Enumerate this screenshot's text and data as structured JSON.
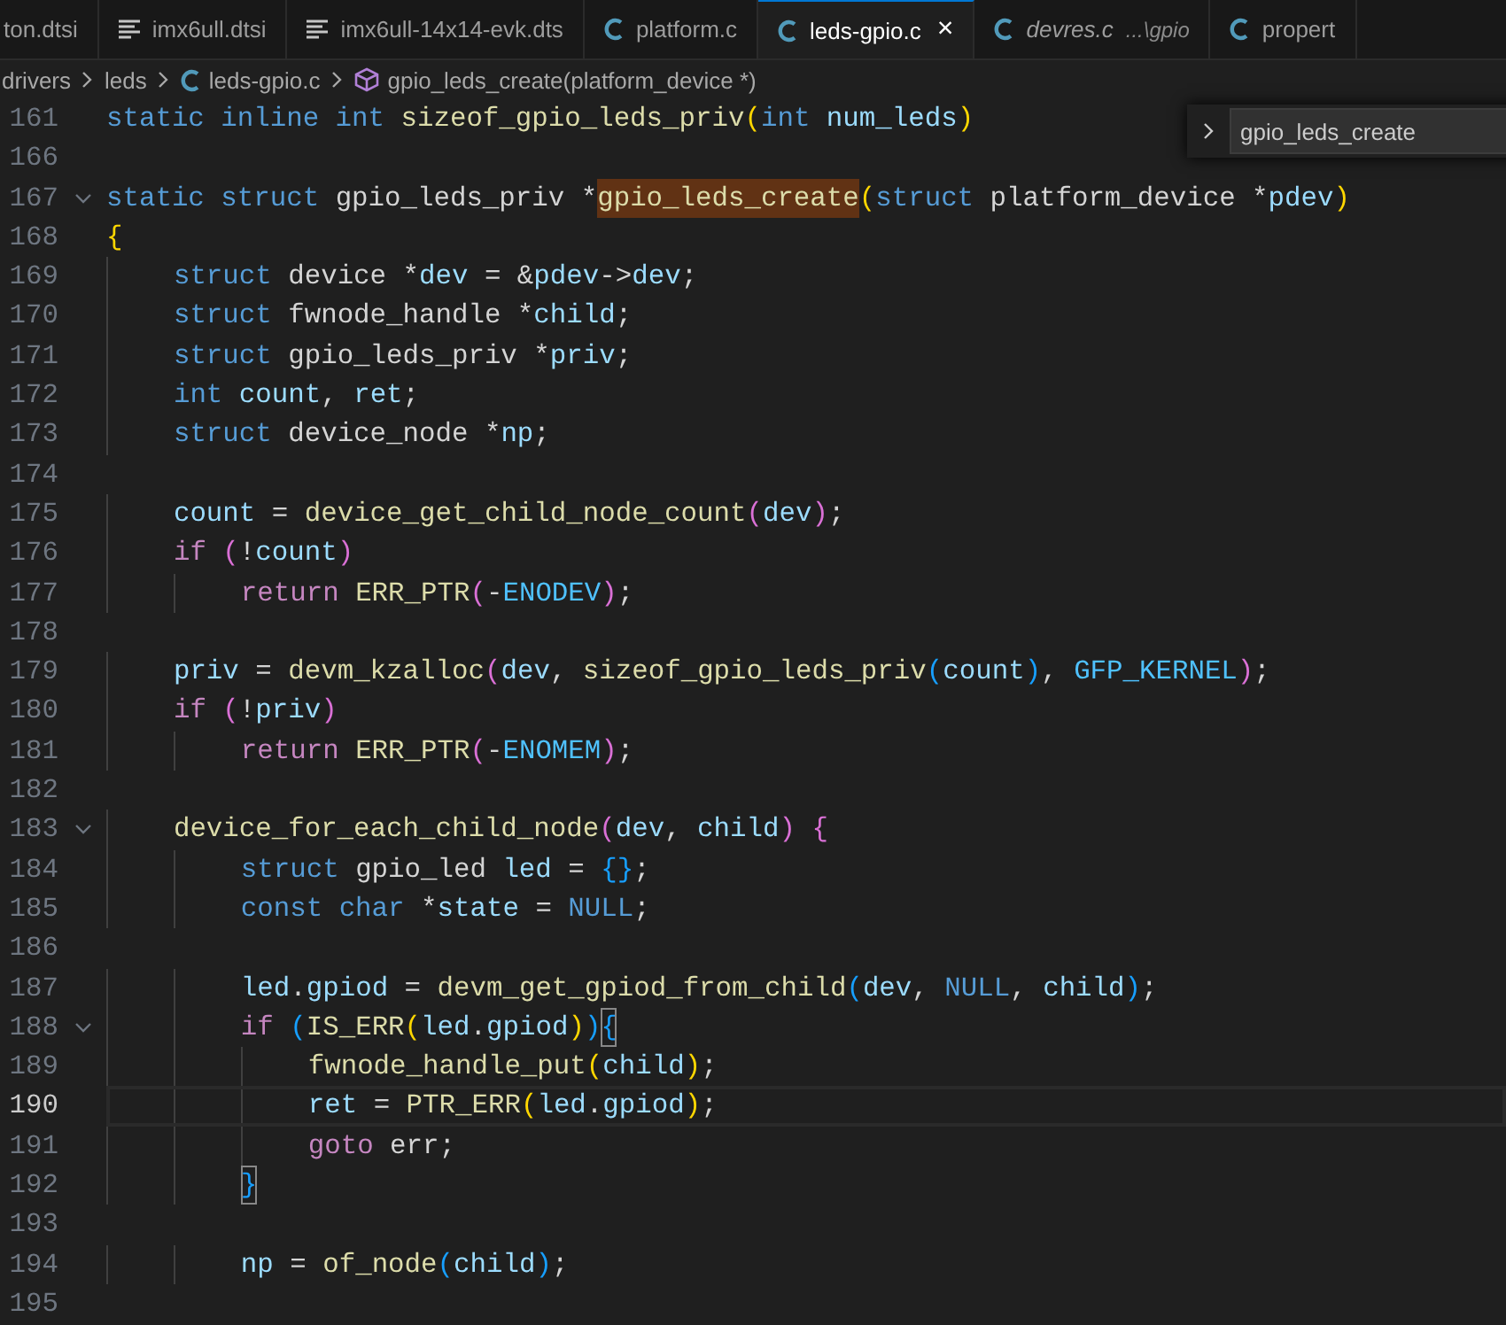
{
  "tabs": [
    {
      "label": "ton.dtsi",
      "kind": "plain",
      "selected": false,
      "preview": false
    },
    {
      "label": "imx6ull.dtsi",
      "kind": "dts",
      "selected": false,
      "preview": false
    },
    {
      "label": "imx6ull-14x14-evk.dts",
      "kind": "dts",
      "selected": false,
      "preview": false
    },
    {
      "label": "platform.c",
      "kind": "c",
      "selected": false,
      "preview": false
    },
    {
      "label": "leds-gpio.c",
      "kind": "c",
      "selected": true,
      "preview": false,
      "close": "×"
    },
    {
      "label": "devres.c",
      "kind": "c",
      "selected": false,
      "preview": true,
      "description": "...\\gpio"
    },
    {
      "label": "propert",
      "kind": "c",
      "selected": false,
      "preview": false
    }
  ],
  "breadcrumb": [
    {
      "label": "drivers",
      "kind": "folder"
    },
    {
      "label": "leds",
      "kind": "folder"
    },
    {
      "label": "leds-gpio.c",
      "kind": "c"
    },
    {
      "label": "gpio_leds_create(platform_device *)",
      "kind": "symbol"
    }
  ],
  "find_widget": {
    "value": "gpio_leds_create"
  },
  "lines": [
    {
      "number": "161",
      "tokens": [
        {
          "kind": "kw",
          "text": "static inline int "
        },
        {
          "kind": "fn",
          "text": "sizeof_gpio_leds_priv"
        },
        {
          "kind": "b1",
          "text": "("
        },
        {
          "kind": "kw",
          "text": "int "
        },
        {
          "kind": "v",
          "text": "num_leds"
        },
        {
          "kind": "b1",
          "text": ")"
        }
      ]
    },
    {
      "number": "166"
    },
    {
      "number": "167",
      "expanded": true,
      "tokens": [
        {
          "kind": "kw",
          "text": "static struct "
        },
        {
          "kind": "p",
          "text": "gpio_leds_priv *"
        },
        {
          "kind": "match",
          "text": "gpio_leds_create"
        },
        {
          "kind": "b1",
          "text": "("
        },
        {
          "kind": "kw",
          "text": "struct "
        },
        {
          "kind": "p",
          "text": "platform_device *"
        },
        {
          "kind": "v",
          "text": "pdev"
        },
        {
          "kind": "b1",
          "text": ")"
        }
      ]
    },
    {
      "number": "168",
      "tokens": [
        {
          "kind": "b1",
          "text": "{"
        }
      ]
    },
    {
      "number": "169",
      "tokens": [
        {
          "kind": "kw",
          "text": "    struct "
        },
        {
          "kind": "p",
          "text": "device *"
        },
        {
          "kind": "v",
          "text": "dev"
        },
        {
          "kind": "p",
          "text": " = &"
        },
        {
          "kind": "v",
          "text": "pdev"
        },
        {
          "kind": "p",
          "text": "->"
        },
        {
          "kind": "v",
          "text": "dev"
        },
        {
          "kind": "p",
          "text": ";"
        }
      ]
    },
    {
      "number": "170",
      "tokens": [
        {
          "kind": "kw",
          "text": "    struct "
        },
        {
          "kind": "p",
          "text": "fwnode_handle *"
        },
        {
          "kind": "v",
          "text": "child"
        },
        {
          "kind": "p",
          "text": ";"
        }
      ]
    },
    {
      "number": "171",
      "tokens": [
        {
          "kind": "kw",
          "text": "    struct "
        },
        {
          "kind": "p",
          "text": "gpio_leds_priv *"
        },
        {
          "kind": "v",
          "text": "priv"
        },
        {
          "kind": "p",
          "text": ";"
        }
      ]
    },
    {
      "number": "172",
      "tokens": [
        {
          "kind": "kw",
          "text": "    int "
        },
        {
          "kind": "v",
          "text": "count"
        },
        {
          "kind": "p",
          "text": ", "
        },
        {
          "kind": "v",
          "text": "ret"
        },
        {
          "kind": "p",
          "text": ";"
        }
      ]
    },
    {
      "number": "173",
      "tokens": [
        {
          "kind": "kw",
          "text": "    struct "
        },
        {
          "kind": "p",
          "text": "device_node *"
        },
        {
          "kind": "v",
          "text": "np"
        },
        {
          "kind": "p",
          "text": ";"
        }
      ]
    },
    {
      "number": "174"
    },
    {
      "number": "175",
      "tokens": [
        {
          "kind": "v",
          "text": "    count"
        },
        {
          "kind": "p",
          "text": " = "
        },
        {
          "kind": "fn",
          "text": "device_get_child_node_count"
        },
        {
          "kind": "b2",
          "text": "("
        },
        {
          "kind": "v",
          "text": "dev"
        },
        {
          "kind": "b2",
          "text": ")"
        },
        {
          "kind": "p",
          "text": ";"
        }
      ]
    },
    {
      "number": "176",
      "tokens": [
        {
          "kind": "ctl",
          "text": "    if "
        },
        {
          "kind": "b2",
          "text": "("
        },
        {
          "kind": "p",
          "text": "!"
        },
        {
          "kind": "v",
          "text": "count"
        },
        {
          "kind": "b2",
          "text": ")"
        }
      ]
    },
    {
      "number": "177",
      "tokens": [
        {
          "kind": "ctl",
          "text": "        return "
        },
        {
          "kind": "fn",
          "text": "ERR_PTR"
        },
        {
          "kind": "b2",
          "text": "("
        },
        {
          "kind": "p",
          "text": "-"
        },
        {
          "kind": "mac",
          "text": "ENODEV"
        },
        {
          "kind": "b2",
          "text": ")"
        },
        {
          "kind": "p",
          "text": ";"
        }
      ]
    },
    {
      "number": "178"
    },
    {
      "number": "179",
      "tokens": [
        {
          "kind": "v",
          "text": "    priv"
        },
        {
          "kind": "p",
          "text": " = "
        },
        {
          "kind": "fn",
          "text": "devm_kzalloc"
        },
        {
          "kind": "b2",
          "text": "("
        },
        {
          "kind": "v",
          "text": "dev"
        },
        {
          "kind": "p",
          "text": ", "
        },
        {
          "kind": "fn",
          "text": "sizeof_gpio_leds_priv"
        },
        {
          "kind": "b3",
          "text": "("
        },
        {
          "kind": "v",
          "text": "count"
        },
        {
          "kind": "b3",
          "text": ")"
        },
        {
          "kind": "p",
          "text": ", "
        },
        {
          "kind": "mac",
          "text": "GFP_KERNEL"
        },
        {
          "kind": "b2",
          "text": ")"
        },
        {
          "kind": "p",
          "text": ";"
        }
      ]
    },
    {
      "number": "180",
      "tokens": [
        {
          "kind": "ctl",
          "text": "    if "
        },
        {
          "kind": "b2",
          "text": "("
        },
        {
          "kind": "p",
          "text": "!"
        },
        {
          "kind": "v",
          "text": "priv"
        },
        {
          "kind": "b2",
          "text": ")"
        }
      ]
    },
    {
      "number": "181",
      "tokens": [
        {
          "kind": "ctl",
          "text": "        return "
        },
        {
          "kind": "fn",
          "text": "ERR_PTR"
        },
        {
          "kind": "b2",
          "text": "("
        },
        {
          "kind": "p",
          "text": "-"
        },
        {
          "kind": "mac",
          "text": "ENOMEM"
        },
        {
          "kind": "b2",
          "text": ")"
        },
        {
          "kind": "p",
          "text": ";"
        }
      ]
    },
    {
      "number": "182"
    },
    {
      "number": "183",
      "expanded": true,
      "tokens": [
        {
          "kind": "fn",
          "text": "    device_for_each_child_node"
        },
        {
          "kind": "b2",
          "text": "("
        },
        {
          "kind": "v",
          "text": "dev"
        },
        {
          "kind": "p",
          "text": ", "
        },
        {
          "kind": "v",
          "text": "child"
        },
        {
          "kind": "b2",
          "text": ") {"
        }
      ]
    },
    {
      "number": "184",
      "tokens": [
        {
          "kind": "kw",
          "text": "        struct "
        },
        {
          "kind": "p",
          "text": "gpio_led "
        },
        {
          "kind": "v",
          "text": "led"
        },
        {
          "kind": "p",
          "text": " = "
        },
        {
          "kind": "b3",
          "text": "{}"
        },
        {
          "kind": "p",
          "text": ";"
        }
      ]
    },
    {
      "number": "185",
      "tokens": [
        {
          "kind": "kw",
          "text": "        const char "
        },
        {
          "kind": "p",
          "text": "*"
        },
        {
          "kind": "v",
          "text": "state"
        },
        {
          "kind": "p",
          "text": " = "
        },
        {
          "kind": "kw",
          "text": "NULL"
        },
        {
          "kind": "p",
          "text": ";"
        }
      ]
    },
    {
      "number": "186"
    },
    {
      "number": "187",
      "tokens": [
        {
          "kind": "v",
          "text": "        led"
        },
        {
          "kind": "p",
          "text": "."
        },
        {
          "kind": "v",
          "text": "gpiod"
        },
        {
          "kind": "p",
          "text": " = "
        },
        {
          "kind": "fn",
          "text": "devm_get_gpiod_from_child"
        },
        {
          "kind": "b3",
          "text": "("
        },
        {
          "kind": "v",
          "text": "dev"
        },
        {
          "kind": "p",
          "text": ", "
        },
        {
          "kind": "kw",
          "text": "NULL"
        },
        {
          "kind": "p",
          "text": ", "
        },
        {
          "kind": "v",
          "text": "child"
        },
        {
          "kind": "b3",
          "text": ")"
        },
        {
          "kind": "p",
          "text": ";"
        }
      ]
    },
    {
      "number": "188",
      "expanded": true,
      "tokens": [
        {
          "kind": "ctl",
          "text": "        if "
        },
        {
          "kind": "b3",
          "text": "("
        },
        {
          "kind": "fn",
          "text": "IS_ERR"
        },
        {
          "kind": "b1",
          "text": "("
        },
        {
          "kind": "v",
          "text": "led"
        },
        {
          "kind": "p",
          "text": "."
        },
        {
          "kind": "v",
          "text": "gpiod"
        },
        {
          "kind": "b1",
          "text": ")"
        },
        {
          "kind": "b3",
          "text": ")"
        },
        {
          "kind": "bm",
          "text": "{"
        }
      ]
    },
    {
      "number": "189",
      "tokens": [
        {
          "kind": "fn",
          "text": "            fwnode_handle_put"
        },
        {
          "kind": "b1",
          "text": "("
        },
        {
          "kind": "v",
          "text": "child"
        },
        {
          "kind": "b1",
          "text": ")"
        },
        {
          "kind": "p",
          "text": ";"
        }
      ]
    },
    {
      "number": "190",
      "current": true,
      "tokens": [
        {
          "kind": "v",
          "text": "            ret"
        },
        {
          "kind": "p",
          "text": " = "
        },
        {
          "kind": "fn",
          "text": "PTR_ERR"
        },
        {
          "kind": "b1",
          "text": "("
        },
        {
          "kind": "v",
          "text": "led"
        },
        {
          "kind": "p",
          "text": "."
        },
        {
          "kind": "v",
          "text": "gpiod"
        },
        {
          "kind": "b1",
          "text": ")"
        },
        {
          "kind": "p",
          "text": ";"
        }
      ]
    },
    {
      "number": "191",
      "tokens": [
        {
          "kind": "ctl",
          "text": "            goto "
        },
        {
          "kind": "p",
          "text": "err;"
        }
      ]
    },
    {
      "number": "192",
      "tokens": [
        {
          "kind": "bm",
          "text": "        }"
        }
      ]
    },
    {
      "number": "193"
    },
    {
      "number": "194",
      "tokens": [
        {
          "kind": "v",
          "text": "        np"
        },
        {
          "kind": "p",
          "text": " = "
        },
        {
          "kind": "fn",
          "text": "of_node"
        },
        {
          "kind": "b3",
          "text": "("
        },
        {
          "kind": "v",
          "text": "child"
        },
        {
          "kind": "b3",
          "text": ")"
        },
        {
          "kind": "p",
          "text": ";"
        }
      ]
    },
    {
      "number": "195"
    }
  ]
}
